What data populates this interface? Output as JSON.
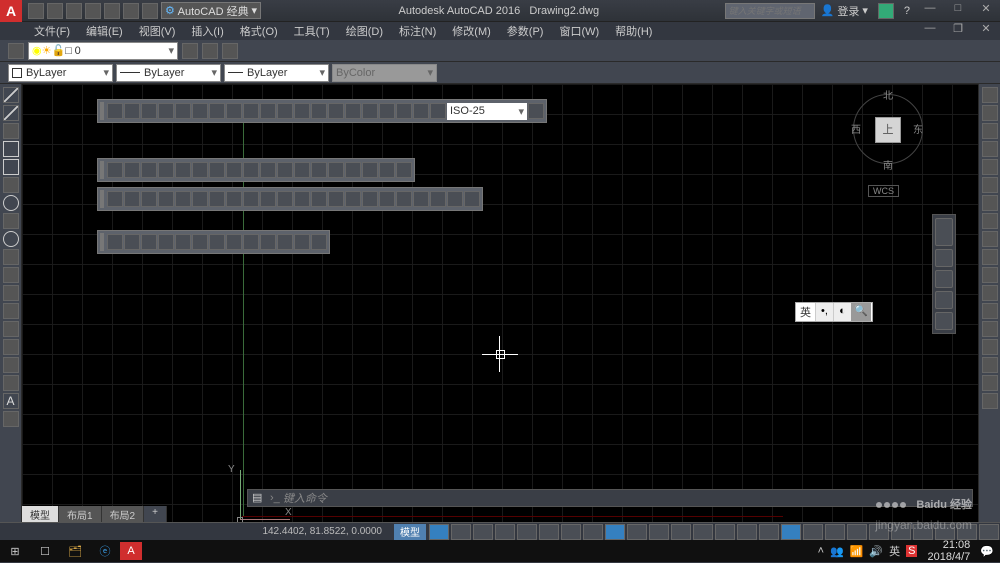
{
  "title": {
    "app": "Autodesk AutoCAD 2016",
    "file": "Drawing2.dwg"
  },
  "search_placeholder": "键入关键字或短语",
  "login": "登录",
  "workspace": "AutoCAD 经典",
  "menu": [
    "文件(F)",
    "编辑(E)",
    "视图(V)",
    "插入(I)",
    "格式(O)",
    "工具(T)",
    "绘图(D)",
    "标注(N)",
    "修改(M)",
    "参数(P)",
    "窗口(W)",
    "帮助(H)"
  ],
  "layer": {
    "current": "0"
  },
  "props": {
    "color": "ByLayer",
    "linetype": "ByLayer",
    "lineweight": "ByLayer",
    "plotstyle": "ByColor"
  },
  "dim_style": "ISO-25",
  "viewcube": {
    "top": "上",
    "n": "北",
    "s": "南",
    "e": "东",
    "w": "西",
    "wcs": "WCS"
  },
  "ucs": {
    "x": "X",
    "y": "Y"
  },
  "ime": {
    "lang": "英"
  },
  "cmd": {
    "prompt": "键入命令",
    "arrow": "›_"
  },
  "tabs": {
    "model": "模型",
    "layout1": "布局1",
    "layout2": "布局2",
    "add": "+"
  },
  "status": {
    "coords": "142.4402, 81.8522, 0.0000",
    "model": "模型"
  },
  "watermark": {
    "brand": "Baidu 经验",
    "url": "jingyan.baidu.com"
  },
  "tray": {
    "time": "21:08",
    "date": "2018/4/7",
    "ime": "英"
  },
  "win": {
    "min": "—",
    "max": "□",
    "close": "✕"
  }
}
